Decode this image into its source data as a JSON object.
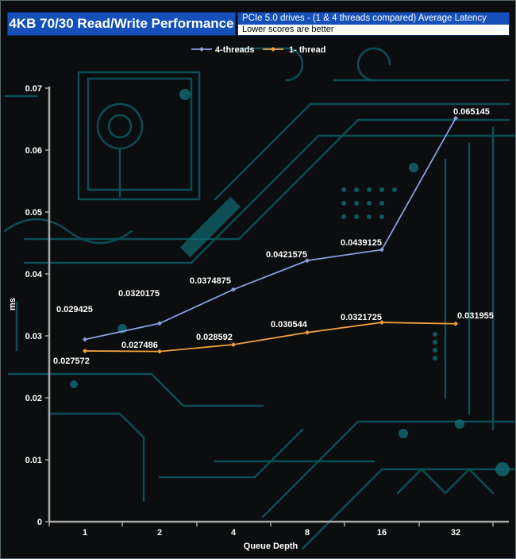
{
  "header": {
    "title": "4KB 70/30 Read/Write Performance",
    "subtitle": "PCIe 5.0 drives - (1 & 4 threads compared)  Average Latency",
    "note": "Lower scores are better"
  },
  "colors": {
    "four_threads": "#8a9ee0",
    "one_thread": "#f0a040",
    "title_bg": "#1550b8",
    "circuit": "#0d5a63"
  },
  "chart_data": {
    "type": "line",
    "title": "4KB 70/30 Read/Write Performance",
    "subtitle": "PCIe 5.0 drives - (1 & 4 threads compared)  Average Latency",
    "xlabel": "Queue Depth",
    "ylabel": "ms",
    "categories": [
      "1",
      "2",
      "4",
      "8",
      "16",
      "32"
    ],
    "ylim": [
      0,
      0.07
    ],
    "yticks": [
      "0",
      "0.01",
      "0.02",
      "0.03",
      "0.04",
      "0.05",
      "0.06",
      "0.07"
    ],
    "ytick_values": [
      0,
      0.01,
      0.02,
      0.03,
      0.04,
      0.05,
      0.06,
      0.07
    ],
    "legend_position": "top",
    "grid": false,
    "series": [
      {
        "name": "4-threads",
        "values": [
          0.029425,
          0.0320175,
          0.0374875,
          0.0421575,
          0.0439125,
          0.065145
        ],
        "labels": [
          "0.029425",
          "0.0320175",
          "0.0374875",
          "0.0421575",
          "0.0439125",
          "0.065145"
        ]
      },
      {
        "name": "1- thread",
        "values": [
          0.027572,
          0.027486,
          0.028592,
          0.030544,
          0.0321725,
          0.031955
        ],
        "labels": [
          "0.027572",
          "0.027486",
          "0.028592",
          "0.030544",
          "0.0321725",
          "0.031955"
        ]
      }
    ]
  }
}
